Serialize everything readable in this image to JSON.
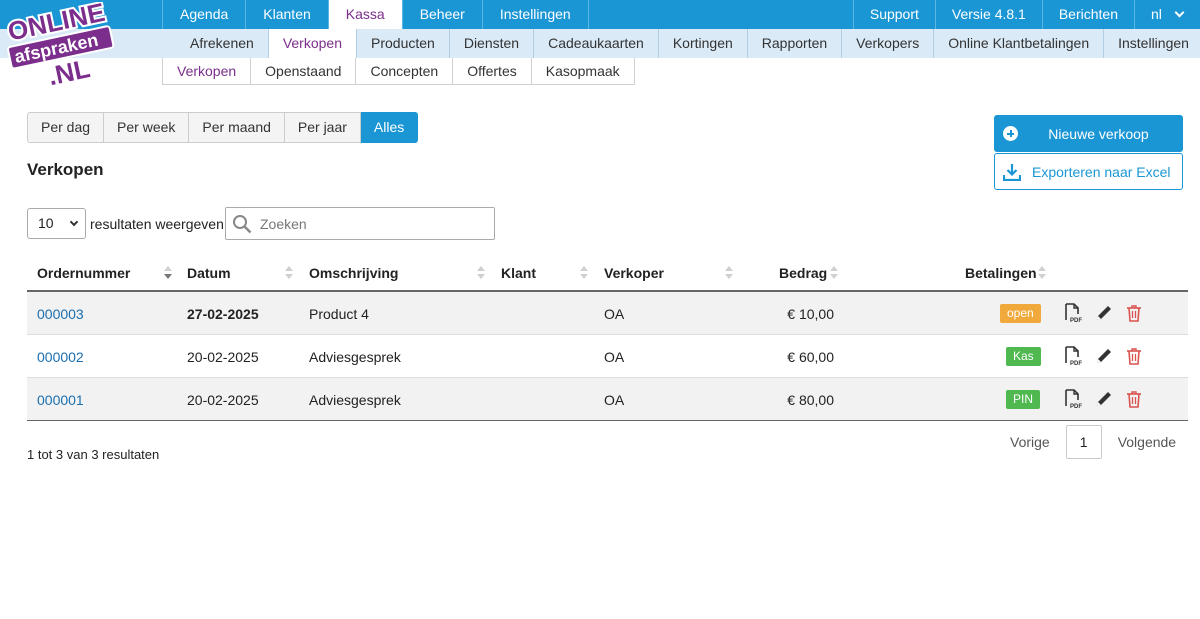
{
  "app": {
    "logo_text": "ONLINE afspraken .NL"
  },
  "topnav": {
    "tabs": [
      {
        "label": "Agenda"
      },
      {
        "label": "Klanten"
      },
      {
        "label": "Kassa",
        "active": true
      },
      {
        "label": "Beheer"
      },
      {
        "label": "Instellingen"
      }
    ],
    "right": {
      "support": "Support",
      "version": "Versie 4.8.1",
      "messages": "Berichten",
      "language": "nl"
    }
  },
  "subnav": {
    "tabs": [
      {
        "label": "Afrekenen"
      },
      {
        "label": "Verkopen",
        "active": true
      },
      {
        "label": "Producten"
      },
      {
        "label": "Diensten"
      },
      {
        "label": "Cadeaukaarten"
      },
      {
        "label": "Kortingen"
      },
      {
        "label": "Rapporten"
      },
      {
        "label": "Verkopers"
      },
      {
        "label": "Online Klantbetalingen"
      },
      {
        "label": "Instellingen"
      }
    ]
  },
  "thirdnav": {
    "tabs": [
      {
        "label": "Verkopen",
        "active": true
      },
      {
        "label": "Openstaand"
      },
      {
        "label": "Concepten"
      },
      {
        "label": "Offertes"
      },
      {
        "label": "Kasopmaak"
      }
    ]
  },
  "periods": {
    "options": [
      "Per dag",
      "Per week",
      "Per maand",
      "Per jaar",
      "Alles"
    ],
    "selected": "Alles"
  },
  "page": {
    "title": "Verkopen"
  },
  "actions": {
    "new_sale": "Nieuwe verkoop",
    "export": "Exporteren naar Excel"
  },
  "table_controls": {
    "length_value": "10",
    "length_label": "resultaten weergeven",
    "search_placeholder": "Zoeken"
  },
  "table": {
    "columns": [
      "Ordernummer",
      "Datum",
      "Omschrijving",
      "Klant",
      "Verkoper",
      "Bedrag",
      "Betalingen"
    ],
    "rows": [
      {
        "order": "000003",
        "date": "27-02-2025",
        "description": "Product 4",
        "customer": "",
        "seller": "OA",
        "amount": "€ 10,00",
        "payment": "open",
        "payment_color": "#f0a93a"
      },
      {
        "order": "000002",
        "date": "20-02-2025",
        "description": "Adviesgesprek",
        "customer": "",
        "seller": "OA",
        "amount": "€ 60,00",
        "payment": "Kas",
        "payment_color": "#4fb84f"
      },
      {
        "order": "000001",
        "date": "20-02-2025",
        "description": "Adviesgesprek",
        "customer": "",
        "seller": "OA",
        "amount": "€ 80,00",
        "payment": "PIN",
        "payment_color": "#4fb84f"
      }
    ]
  },
  "footer": {
    "info": "1 tot 3 van 3 resultaten",
    "prev": "Vorige",
    "page": "1",
    "next": "Volgende"
  },
  "colors": {
    "primary": "#1a96d5",
    "accent": "#7b2e8c",
    "link": "#1a6fb0",
    "delete": "#d9534f"
  }
}
